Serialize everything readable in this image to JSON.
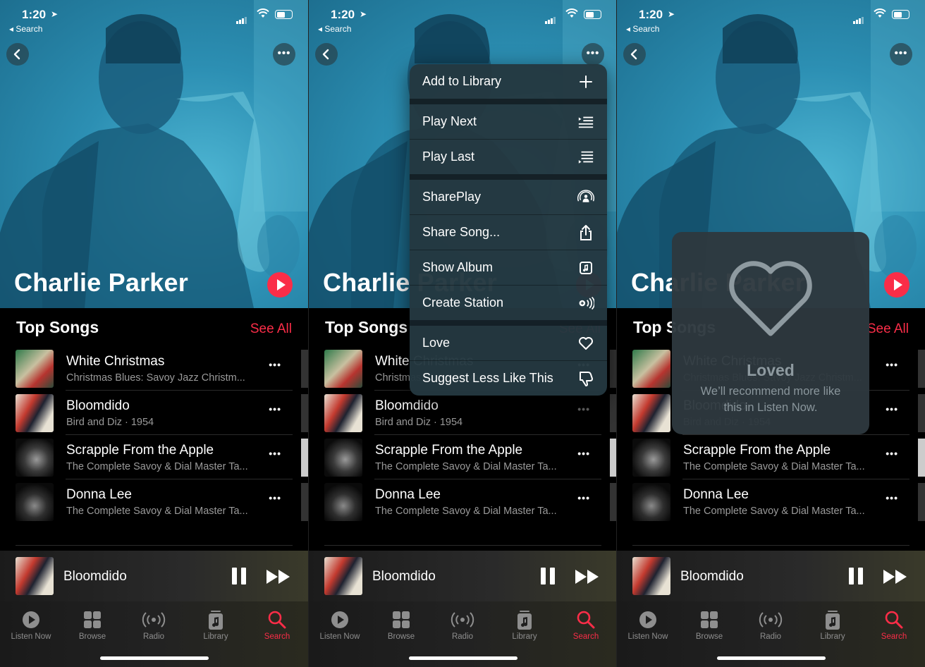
{
  "status": {
    "time": "1:20",
    "back_label": "◂ Search"
  },
  "artist": {
    "name": "Charlie Parker"
  },
  "section": {
    "title": "Top Songs",
    "see_all": "See All"
  },
  "songs": [
    {
      "title": "White Christmas",
      "subtitle": "Christmas Blues: Savoy Jazz Christm..."
    },
    {
      "title": "Bloomdido",
      "subtitle": "Bird and Diz · 1954"
    },
    {
      "title": "Scrapple From the Apple",
      "subtitle": "The Complete Savoy & Dial Master Ta..."
    },
    {
      "title": "Donna Lee",
      "subtitle": "The Complete Savoy & Dial Master Ta..."
    }
  ],
  "mini_player": {
    "title": "Bloomdido"
  },
  "tabs": [
    {
      "label": "Listen Now"
    },
    {
      "label": "Browse"
    },
    {
      "label": "Radio"
    },
    {
      "label": "Library"
    },
    {
      "label": "Search"
    }
  ],
  "context_menu": {
    "items": [
      {
        "label": "Add to Library",
        "icon": "plus-icon"
      },
      {
        "label": "Play Next",
        "icon": "play-next-icon"
      },
      {
        "label": "Play Last",
        "icon": "play-last-icon"
      },
      {
        "label": "SharePlay",
        "icon": "shareplay-icon"
      },
      {
        "label": "Share Song...",
        "icon": "share-icon"
      },
      {
        "label": "Show Album",
        "icon": "album-icon"
      },
      {
        "label": "Create Station",
        "icon": "station-icon"
      },
      {
        "label": "Love",
        "icon": "heart-icon"
      },
      {
        "label": "Suggest Less Like This",
        "icon": "thumbs-down-icon"
      }
    ]
  },
  "loved_toast": {
    "title": "Loved",
    "description": "We’ll recommend more like this in Listen Now."
  },
  "colors": {
    "accent": "#fa2d48",
    "hero": "#2c8fb3"
  }
}
